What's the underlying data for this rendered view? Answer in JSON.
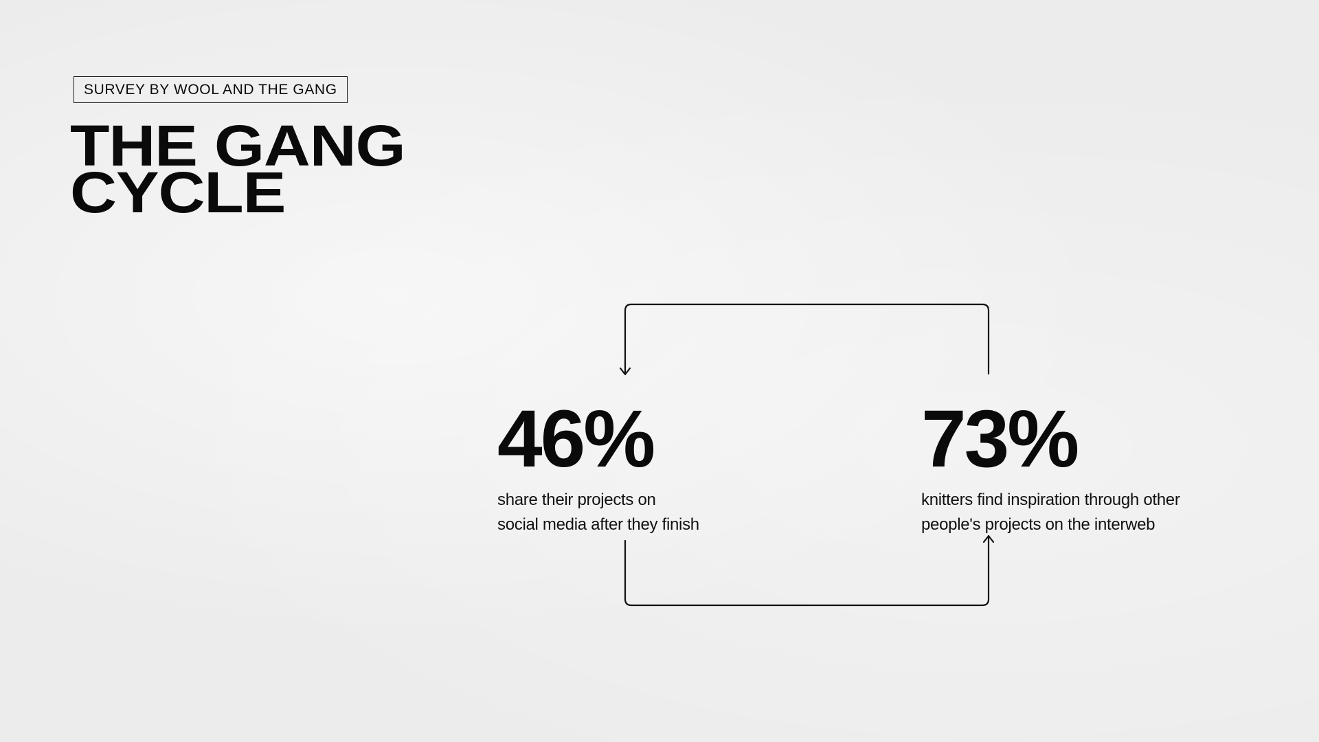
{
  "header": {
    "badge": "SURVEY BY WOOL AND THE GANG",
    "title_line_1": "THE GANG",
    "title_line_2": "CYCLE"
  },
  "stats": [
    {
      "value": "46%",
      "desc_line_1": "share their projects on",
      "desc_line_2": "social media after they finish"
    },
    {
      "value": "73%",
      "desc_line_1": "knitters find inspiration through other",
      "desc_line_2": "people's projects on the interweb"
    }
  ],
  "colors": {
    "background": "#ececec",
    "ink": "#0a0a0a"
  }
}
